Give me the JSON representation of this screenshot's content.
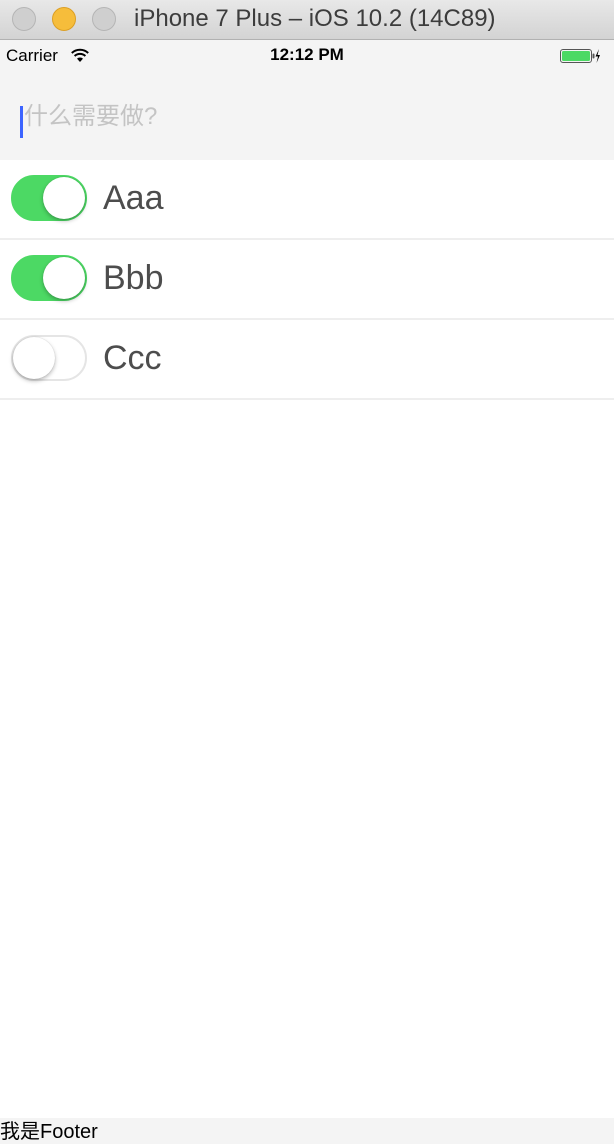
{
  "window": {
    "title": "iPhone 7 Plus – iOS 10.2 (14C89)"
  },
  "status_bar": {
    "carrier": "Carrier",
    "time": "12:12 PM",
    "wifi_icon": "wifi-icon",
    "battery_icon": "battery-charging-icon"
  },
  "header": {
    "input_placeholder": "什么需要做?",
    "input_value": ""
  },
  "todos": [
    {
      "label": "Aaa",
      "done": true
    },
    {
      "label": "Bbb",
      "done": true
    },
    {
      "label": "Ccc",
      "done": false
    }
  ],
  "footer": {
    "text": "我是Footer"
  },
  "colors": {
    "switch_on": "#4cd964",
    "caret": "#3c64ff",
    "battery": "#4cd964"
  }
}
